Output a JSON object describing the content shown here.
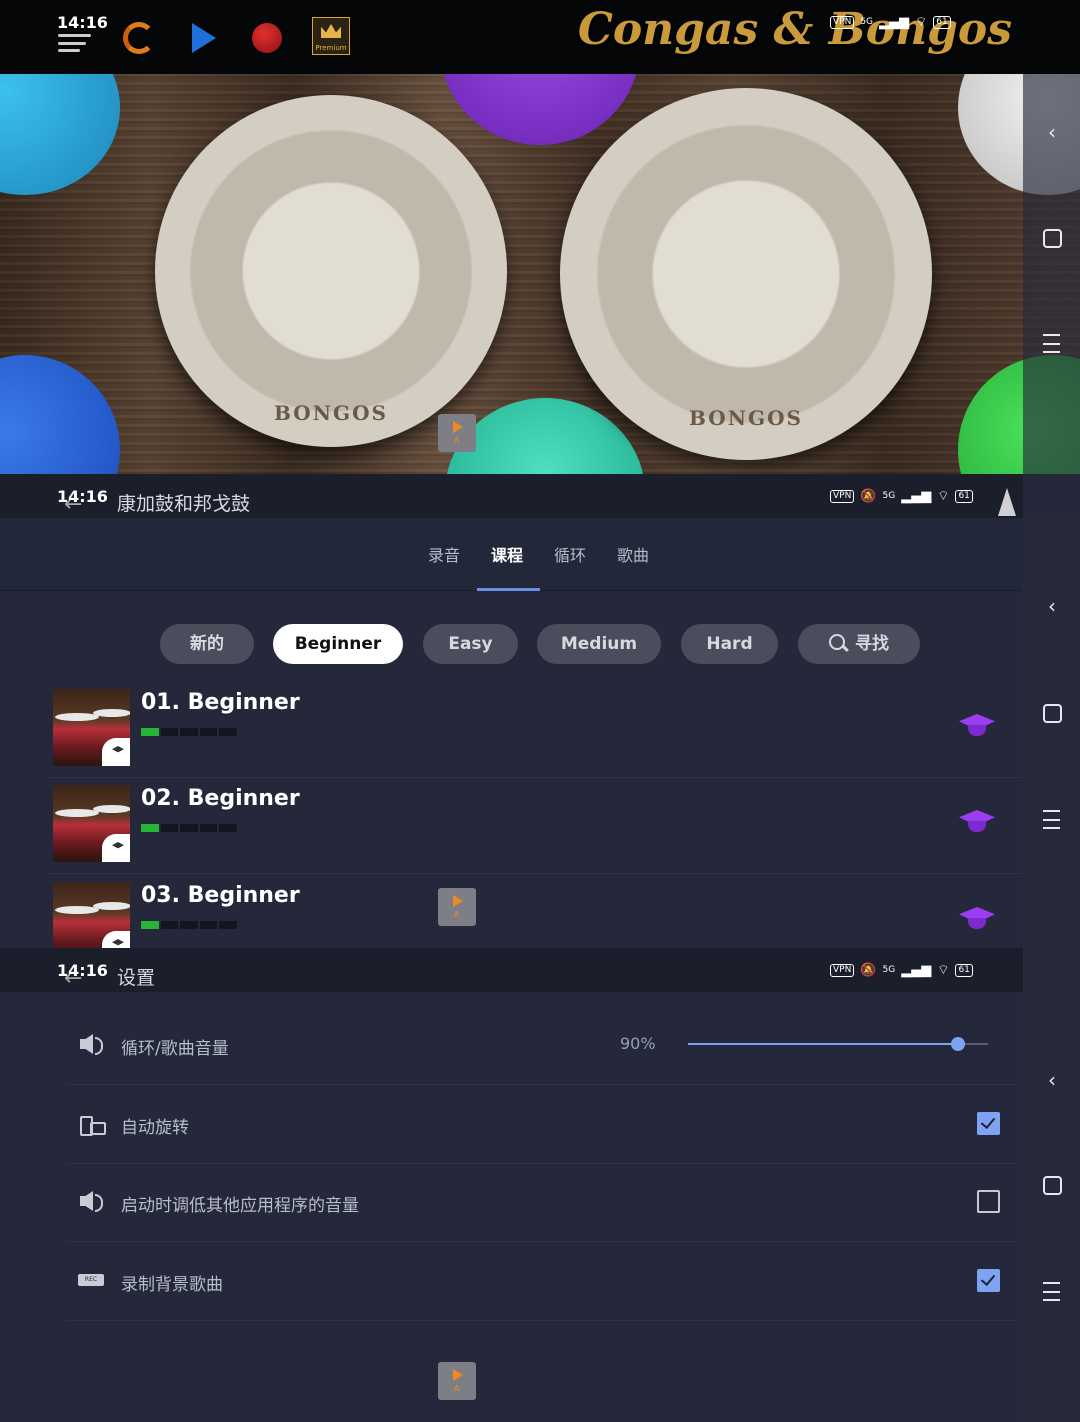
{
  "status_bar": {
    "time": "14:16",
    "vpn": "VPN",
    "network": "5G",
    "battery": "61"
  },
  "drum_app": {
    "title": "Congas & Bongos",
    "premium_label": "Premium",
    "drums": [
      {
        "label": "BONGOS"
      },
      {
        "label": "BONGOS"
      }
    ],
    "pad_colors": {
      "cyan": "#2aa5d8",
      "purple": "#7b2fc8",
      "white": "#dcdcdc",
      "blue": "#1f55c8",
      "teal": "#25c8a8",
      "green": "#2ab83e"
    }
  },
  "lessons_screen": {
    "title": "康加鼓和邦戈鼓",
    "tabs": [
      {
        "label": "录音",
        "active": false
      },
      {
        "label": "课程",
        "active": true
      },
      {
        "label": "循环",
        "active": false
      },
      {
        "label": "歌曲",
        "active": false
      }
    ],
    "filters": [
      {
        "label": "新的",
        "active": false
      },
      {
        "label": "Beginner",
        "active": true
      },
      {
        "label": "Easy",
        "active": false
      },
      {
        "label": "Medium",
        "active": false
      },
      {
        "label": "Hard",
        "active": false
      },
      {
        "label": "寻找",
        "active": false,
        "icon": "search-icon"
      }
    ],
    "lessons": [
      {
        "title": "01. Beginner",
        "progress": 0.2
      },
      {
        "title": "02. Beginner",
        "progress": 0.2
      },
      {
        "title": "03. Beginner",
        "progress": 0.2
      }
    ]
  },
  "settings_screen": {
    "title": "设置",
    "rows": [
      {
        "label": "循环/歌曲音量",
        "icon": "speaker-icon",
        "value": "90%",
        "slider": 0.9
      },
      {
        "label": "自动旋转",
        "icon": "rotate-icon",
        "checked": true
      },
      {
        "label": "启动时调低其他应用程序的音量",
        "icon": "speaker-icon",
        "checked": false
      },
      {
        "label": "录制背景歌曲",
        "icon": "rec-icon",
        "rec_text": "REC",
        "checked": true
      }
    ]
  },
  "colors": {
    "accent": "#7ea3f3",
    "background": "#24283a",
    "lesson_icon": "#9b3df0",
    "progress_on": "#28b33a"
  }
}
